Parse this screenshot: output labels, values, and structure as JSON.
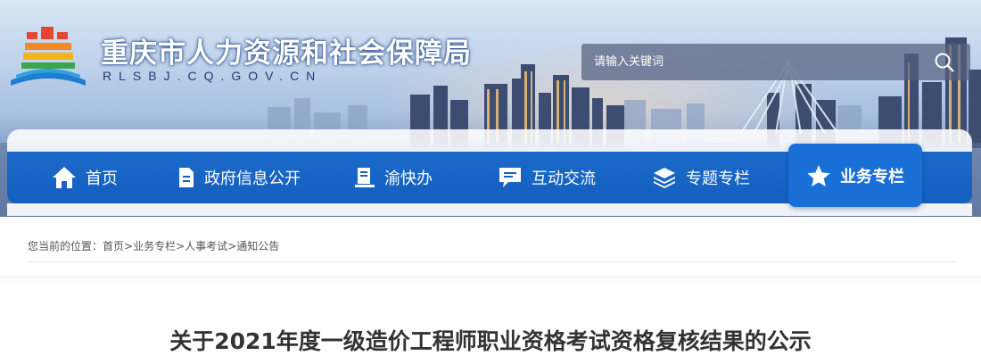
{
  "header": {
    "site_title": "重庆市人力资源和社会保障局",
    "site_domain": "RLSBJ.CQ.GOV.CN",
    "logo_icon": "cq-hrss-logo-icon",
    "search": {
      "placeholder": "请输入关键词",
      "button_icon": "search-icon"
    }
  },
  "nav": {
    "items": [
      {
        "label": "首页",
        "icon": "home-icon",
        "active": false
      },
      {
        "label": "政府信息公开",
        "icon": "document-icon",
        "active": false
      },
      {
        "label": "渝快办",
        "icon": "service-book-icon",
        "active": false
      },
      {
        "label": "互动交流",
        "icon": "chat-icon",
        "active": false
      },
      {
        "label": "专题专栏",
        "icon": "layers-icon",
        "active": false
      },
      {
        "label": "业务专栏",
        "icon": "star-icon",
        "active": true
      }
    ],
    "active_color": "#1a6fd6",
    "bar_color": "#1460bf"
  },
  "breadcrumb": {
    "prefix": "您当前的位置：",
    "items": [
      "首页",
      "业务专栏",
      "人事考试",
      "通知公告"
    ],
    "separator": ">"
  },
  "article": {
    "title": "关于2021年度一级造价工程师职业资格考试资格复核结果的公示"
  }
}
